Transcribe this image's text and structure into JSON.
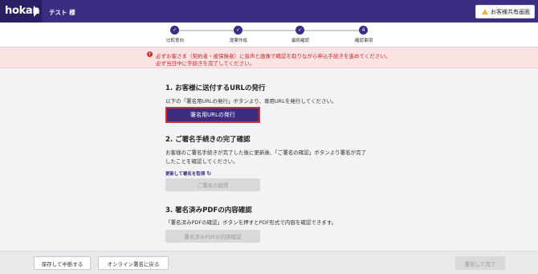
{
  "header": {
    "logo": "hokan",
    "user_name": "テスト 様",
    "share_button": "お客様共有画面"
  },
  "stepper": {
    "steps": [
      {
        "label": "比較意向",
        "marker": "✓"
      },
      {
        "label": "提案作成",
        "marker": "✓"
      },
      {
        "label": "最終確認",
        "marker": "✓"
      },
      {
        "label": "確認事項",
        "marker": "4"
      }
    ]
  },
  "alert": {
    "line1": "必ずお客さま（契約者・被保険者）に音声と画像で確認を取りながら申込手続きを進めてください。",
    "line2": "必ず当日中に手続きを完了してください。"
  },
  "section1": {
    "title": "1. お客様に送付するURLの発行",
    "description": "以下の「署名用URLの発行」ボタンより、専用URLを発行してください。",
    "button": "署名用URLの発行"
  },
  "section2": {
    "title": "2. ご署名手続きの完了確認",
    "description_line1": "お客様のご署名手続きが完了した後に更新後、「ご署名の確認」ボタンより署名が完了",
    "description_line2": "したことを確認してください。",
    "refresh_link": "更新して署名を取得",
    "button": "ご署名の取得"
  },
  "section3": {
    "title": "3. 署名済みPDFの内容確認",
    "description": "「署名済みPDFの確認」ボタンを押すとPDF形式で内容を確認できます。",
    "button": "署名済みPDFの内容確認"
  },
  "footer": {
    "save_button": "保存して中断する",
    "back_button": "オンライン署名に戻る",
    "finish_button": "署名して完了"
  },
  "colors": {
    "brand": "#3b2d82",
    "alert_bg": "#fbe3e3",
    "alert_text": "#c62828",
    "disabled": "#d9d9dc"
  }
}
